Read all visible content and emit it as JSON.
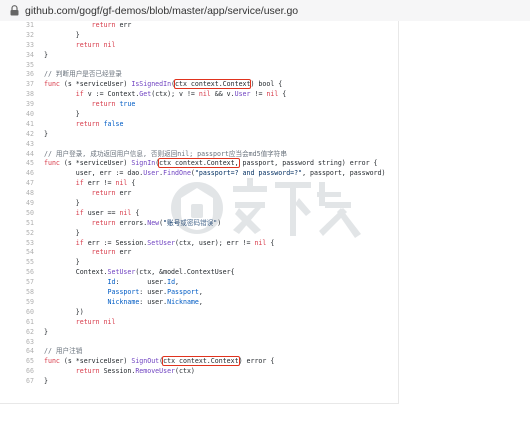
{
  "browser": {
    "url": "github.com/gogf/gf-demos/blob/master/app/service/user.go"
  },
  "code_lines": [
    {
      "n": "31",
      "tokens": [
        [
          "",
          "            "
        ],
        [
          "kw",
          "return"
        ],
        [
          "",
          " err"
        ]
      ]
    },
    {
      "n": "32",
      "tokens": [
        [
          "",
          "        }"
        ]
      ]
    },
    {
      "n": "33",
      "tokens": [
        [
          "",
          "        "
        ],
        [
          "kw",
          "return"
        ],
        [
          "",
          " "
        ],
        [
          "kw",
          "nil"
        ]
      ]
    },
    {
      "n": "34",
      "tokens": [
        [
          "",
          "}"
        ]
      ]
    },
    {
      "n": "35",
      "tokens": [
        [
          "",
          ""
        ]
      ]
    },
    {
      "n": "36",
      "tokens": [
        [
          "cm",
          "// 判断用户是否已经登录"
        ]
      ]
    },
    {
      "n": "37",
      "tokens": [
        [
          "kw",
          "func"
        ],
        [
          "",
          " (s *serviceUser) "
        ],
        [
          "fn",
          "IsSignedIn"
        ],
        [
          "",
          "("
        ],
        [
          "hl",
          "ctx context.Context"
        ],
        [
          "",
          ") bool {"
        ]
      ]
    },
    {
      "n": "38",
      "tokens": [
        [
          "",
          "        "
        ],
        [
          "kw",
          "if"
        ],
        [
          "",
          " v := Context."
        ],
        [
          "fn",
          "Get"
        ],
        [
          "",
          "(ctx); v != "
        ],
        [
          "kw",
          "nil"
        ],
        [
          "",
          " && v."
        ],
        [
          "fn",
          "User"
        ],
        [
          "",
          " != "
        ],
        [
          "kw",
          "nil"
        ],
        [
          "",
          " {"
        ]
      ]
    },
    {
      "n": "39",
      "tokens": [
        [
          "",
          "            "
        ],
        [
          "kw",
          "return"
        ],
        [
          "",
          " "
        ],
        [
          "nm",
          "true"
        ]
      ]
    },
    {
      "n": "40",
      "tokens": [
        [
          "",
          "        }"
        ]
      ]
    },
    {
      "n": "41",
      "tokens": [
        [
          "",
          "        "
        ],
        [
          "kw",
          "return"
        ],
        [
          "",
          " "
        ],
        [
          "nm",
          "false"
        ]
      ]
    },
    {
      "n": "42",
      "tokens": [
        [
          "",
          "}"
        ]
      ]
    },
    {
      "n": "43",
      "tokens": [
        [
          "",
          ""
        ]
      ]
    },
    {
      "n": "44",
      "tokens": [
        [
          "cm",
          "// 用户登录, 成功返回用户信息, 否则返回nil; passport应当会md5值字符串"
        ]
      ]
    },
    {
      "n": "45",
      "tokens": [
        [
          "kw",
          "func"
        ],
        [
          "",
          " (s *serviceUser) "
        ],
        [
          "fn",
          "SignIn"
        ],
        [
          "",
          "("
        ],
        [
          "hl",
          "ctx context.Context,"
        ],
        [
          "",
          " passport, password string) error {"
        ]
      ]
    },
    {
      "n": "46",
      "tokens": [
        [
          "",
          "        user, err := dao."
        ],
        [
          "fn",
          "User"
        ],
        [
          "",
          "."
        ],
        [
          "fn",
          "FindOne"
        ],
        [
          "",
          "("
        ],
        [
          "str",
          "\"passport=? and password=?\""
        ],
        [
          "",
          ", passport, password)"
        ]
      ]
    },
    {
      "n": "47",
      "tokens": [
        [
          "",
          "        "
        ],
        [
          "kw",
          "if"
        ],
        [
          "",
          " err != "
        ],
        [
          "kw",
          "nil"
        ],
        [
          "",
          " {"
        ]
      ]
    },
    {
      "n": "48",
      "tokens": [
        [
          "",
          "            "
        ],
        [
          "kw",
          "return"
        ],
        [
          "",
          " err"
        ]
      ]
    },
    {
      "n": "49",
      "tokens": [
        [
          "",
          "        }"
        ]
      ]
    },
    {
      "n": "50",
      "tokens": [
        [
          "",
          "        "
        ],
        [
          "kw",
          "if"
        ],
        [
          "",
          " user == "
        ],
        [
          "kw",
          "nil"
        ],
        [
          "",
          " {"
        ]
      ]
    },
    {
      "n": "51",
      "tokens": [
        [
          "",
          "            "
        ],
        [
          "kw",
          "return"
        ],
        [
          "",
          " errors."
        ],
        [
          "fn",
          "New"
        ],
        [
          "",
          "("
        ],
        [
          "str",
          "\"账号或密码错误\""
        ],
        [
          "",
          ")"
        ]
      ]
    },
    {
      "n": "52",
      "tokens": [
        [
          "",
          "        }"
        ]
      ]
    },
    {
      "n": "53",
      "tokens": [
        [
          "",
          "        "
        ],
        [
          "kw",
          "if"
        ],
        [
          "",
          " err := Session."
        ],
        [
          "fn",
          "SetUser"
        ],
        [
          "",
          "(ctx, user); err != "
        ],
        [
          "kw",
          "nil"
        ],
        [
          "",
          " {"
        ]
      ]
    },
    {
      "n": "54",
      "tokens": [
        [
          "",
          "            "
        ],
        [
          "kw",
          "return"
        ],
        [
          "",
          " err"
        ]
      ]
    },
    {
      "n": "55",
      "tokens": [
        [
          "",
          "        }"
        ]
      ]
    },
    {
      "n": "56",
      "tokens": [
        [
          "",
          "        Context."
        ],
        [
          "fn",
          "SetUser"
        ],
        [
          "",
          "(ctx, &model.ContextUser{"
        ]
      ]
    },
    {
      "n": "57",
      "tokens": [
        [
          "",
          "                "
        ],
        [
          "nm",
          "Id"
        ],
        [
          "",
          ":       user."
        ],
        [
          "nm",
          "Id"
        ],
        [
          "",
          ","
        ]
      ]
    },
    {
      "n": "58",
      "tokens": [
        [
          "",
          "                "
        ],
        [
          "nm",
          "Passport"
        ],
        [
          "",
          ": user."
        ],
        [
          "nm",
          "Passport"
        ],
        [
          "",
          ","
        ]
      ]
    },
    {
      "n": "59",
      "tokens": [
        [
          "",
          "                "
        ],
        [
          "nm",
          "Nickname"
        ],
        [
          "",
          ": user."
        ],
        [
          "nm",
          "Nickname"
        ],
        [
          "",
          ","
        ]
      ]
    },
    {
      "n": "60",
      "tokens": [
        [
          "",
          "        })"
        ]
      ]
    },
    {
      "n": "61",
      "tokens": [
        [
          "",
          "        "
        ],
        [
          "kw",
          "return"
        ],
        [
          "",
          " "
        ],
        [
          "kw",
          "nil"
        ]
      ]
    },
    {
      "n": "62",
      "tokens": [
        [
          "",
          "}"
        ]
      ]
    },
    {
      "n": "63",
      "tokens": [
        [
          "",
          ""
        ]
      ]
    },
    {
      "n": "64",
      "tokens": [
        [
          "cm",
          "// 用户注销"
        ]
      ]
    },
    {
      "n": "65",
      "tokens": [
        [
          "kw",
          "func"
        ],
        [
          "",
          " (s *serviceUser) "
        ],
        [
          "fn",
          "SignOut"
        ],
        [
          "",
          "("
        ],
        [
          "hl",
          "ctx context.Context"
        ],
        [
          "",
          ") error {"
        ]
      ]
    },
    {
      "n": "66",
      "tokens": [
        [
          "",
          "        "
        ],
        [
          "kw",
          "return"
        ],
        [
          "",
          " Session."
        ],
        [
          "fn",
          "RemoveUser"
        ],
        [
          "",
          "(ctx)"
        ]
      ]
    },
    {
      "n": "67",
      "tokens": [
        [
          "",
          "}"
        ]
      ]
    }
  ],
  "colors": {
    "keyword": "#d73a49",
    "function": "#6f42c1",
    "comment": "#6a737d",
    "string": "#032f62",
    "highlight_box": "#e0331e"
  },
  "icons": {
    "address_bar": "lock-icon",
    "watermark": "anxz-logo-watermark"
  }
}
